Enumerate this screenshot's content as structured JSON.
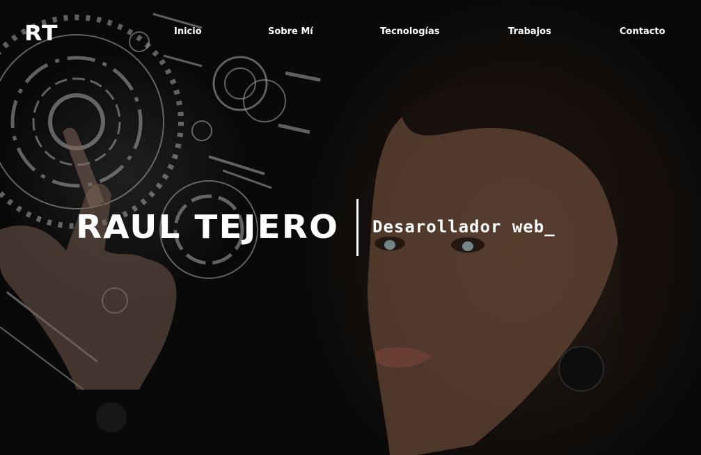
{
  "brand": {
    "logo": "RT"
  },
  "nav": {
    "items": [
      {
        "label": "Inicio"
      },
      {
        "label": "Sobre Mí"
      },
      {
        "label": "Tecnologías"
      },
      {
        "label": "Trabajos"
      },
      {
        "label": "Contacto"
      }
    ]
  },
  "hero": {
    "name": "RAUL TEJERO",
    "role": "Desarollador web",
    "cursor": "_"
  },
  "colors": {
    "text": "#ffffff",
    "background": "#0b0b0b"
  },
  "icons": {
    "background_image": "hologram-interface-woman-image"
  }
}
